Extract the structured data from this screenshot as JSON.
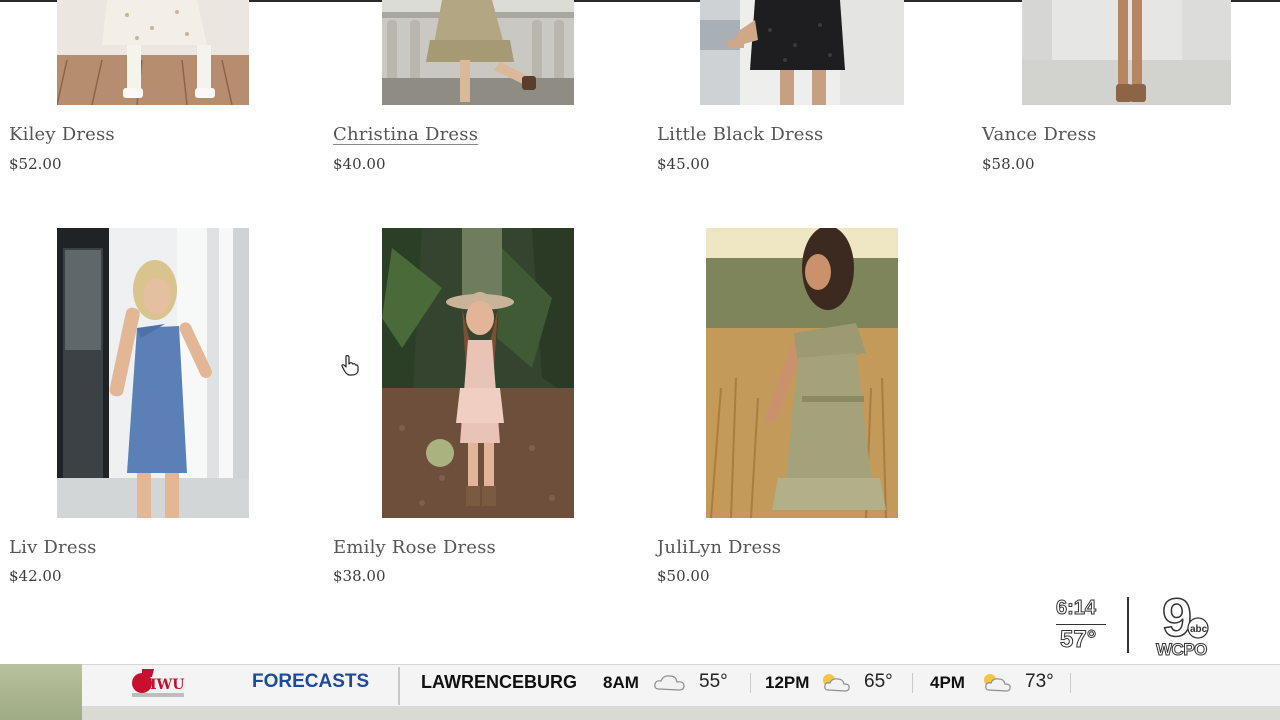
{
  "products": [
    {
      "name": "Kiley Dress",
      "price": "$52.00"
    },
    {
      "name": "Christina Dress",
      "price": "$40.00"
    },
    {
      "name": "Little Black Dress",
      "price": "$45.00"
    },
    {
      "name": "Vance Dress",
      "price": "$58.00"
    },
    {
      "name": "Liv Dress",
      "price": "$42.00"
    },
    {
      "name": "Emily Rose Dress",
      "price": "$38.00"
    },
    {
      "name": "JuliLyn Dress",
      "price": "$50.00"
    }
  ],
  "overlay": {
    "ticker_label": "FORECASTS",
    "city": "LAWRENCEBURG",
    "slots": [
      {
        "time": "8AM",
        "temp": "55°",
        "icon": "cloudy-icon"
      },
      {
        "time": "12PM",
        "temp": "65°",
        "icon": "partly-sunny-icon"
      },
      {
        "time": "4PM",
        "temp": "73°",
        "icon": "partly-sunny-icon"
      }
    ],
    "clock": "6:14",
    "current_temp": "57°",
    "station": "WCPO",
    "channel": "9",
    "network": "abc"
  },
  "colors": {
    "ticker_accent": "#1f4a9a",
    "ticker_bg": "#f4f4f4",
    "green_bar": "#a9b38e"
  }
}
